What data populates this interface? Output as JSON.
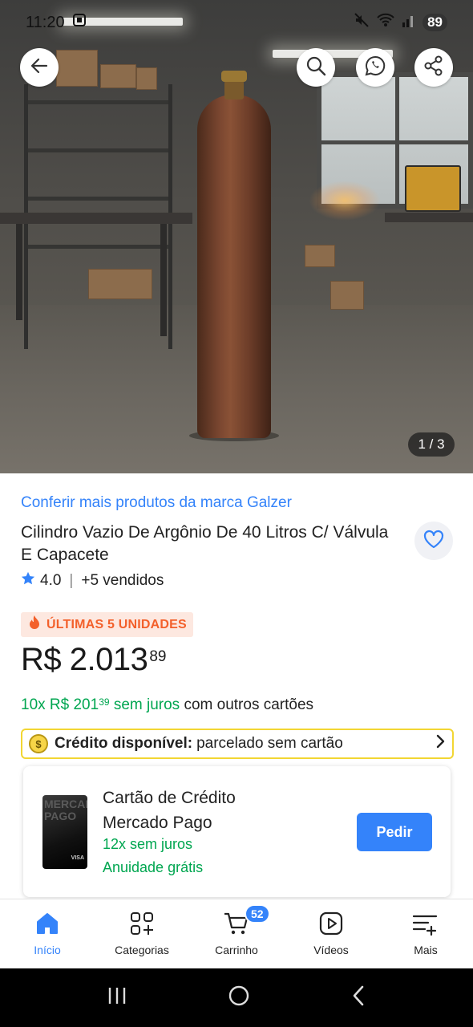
{
  "status_bar": {
    "time": "11:20",
    "battery": "89"
  },
  "hero": {
    "pager": "1 / 3"
  },
  "product": {
    "brand_link": "Conferir mais produtos da marca Galzer",
    "title": "Cilindro Vazio De Argônio De 40 Litros C/ Válvula E Capacete",
    "rating": "4.0",
    "sold": "+5 vendidos",
    "badge": "ÚLTIMAS 5 UNIDADES",
    "price_main": "R$ 2.013",
    "price_cents": "89",
    "installments_prefix": "10x R$ 201",
    "installments_cents": "39",
    "installments_green_suffix": " sem juros",
    "installments_rest": " com outros cartões"
  },
  "credit": {
    "coin": "$",
    "label": "Crédito disponível:",
    "text": "parcelado sem cartão"
  },
  "card_offer": {
    "title_line1": "Cartão de Crédito",
    "title_line2": "Mercado Pago",
    "line1": "12x sem juros",
    "line2": "Anuidade grátis",
    "button": "Pedir",
    "card_art_text": "MERCADO PAGO",
    "card_brand": "VISA"
  },
  "bottom_nav": {
    "items": [
      {
        "label": "Início"
      },
      {
        "label": "Categorias"
      },
      {
        "label": "Carrinho"
      },
      {
        "label": "Vídeos"
      },
      {
        "label": "Mais"
      }
    ],
    "cart_count": "52"
  },
  "colors": {
    "accent": "#3483fa",
    "green": "#00a650",
    "badge_orange": "#f3602b",
    "credit_border": "#f2d633"
  },
  "icons": {
    "hero": [
      "back-arrow-icon",
      "search-icon",
      "whatsapp-icon",
      "share-icon"
    ],
    "status": [
      "mute-icon",
      "wifi-icon",
      "signal-icon",
      "screenshot-icon"
    ],
    "nav": [
      "home-icon",
      "categories-icon",
      "cart-icon",
      "video-icon",
      "more-icon"
    ]
  }
}
